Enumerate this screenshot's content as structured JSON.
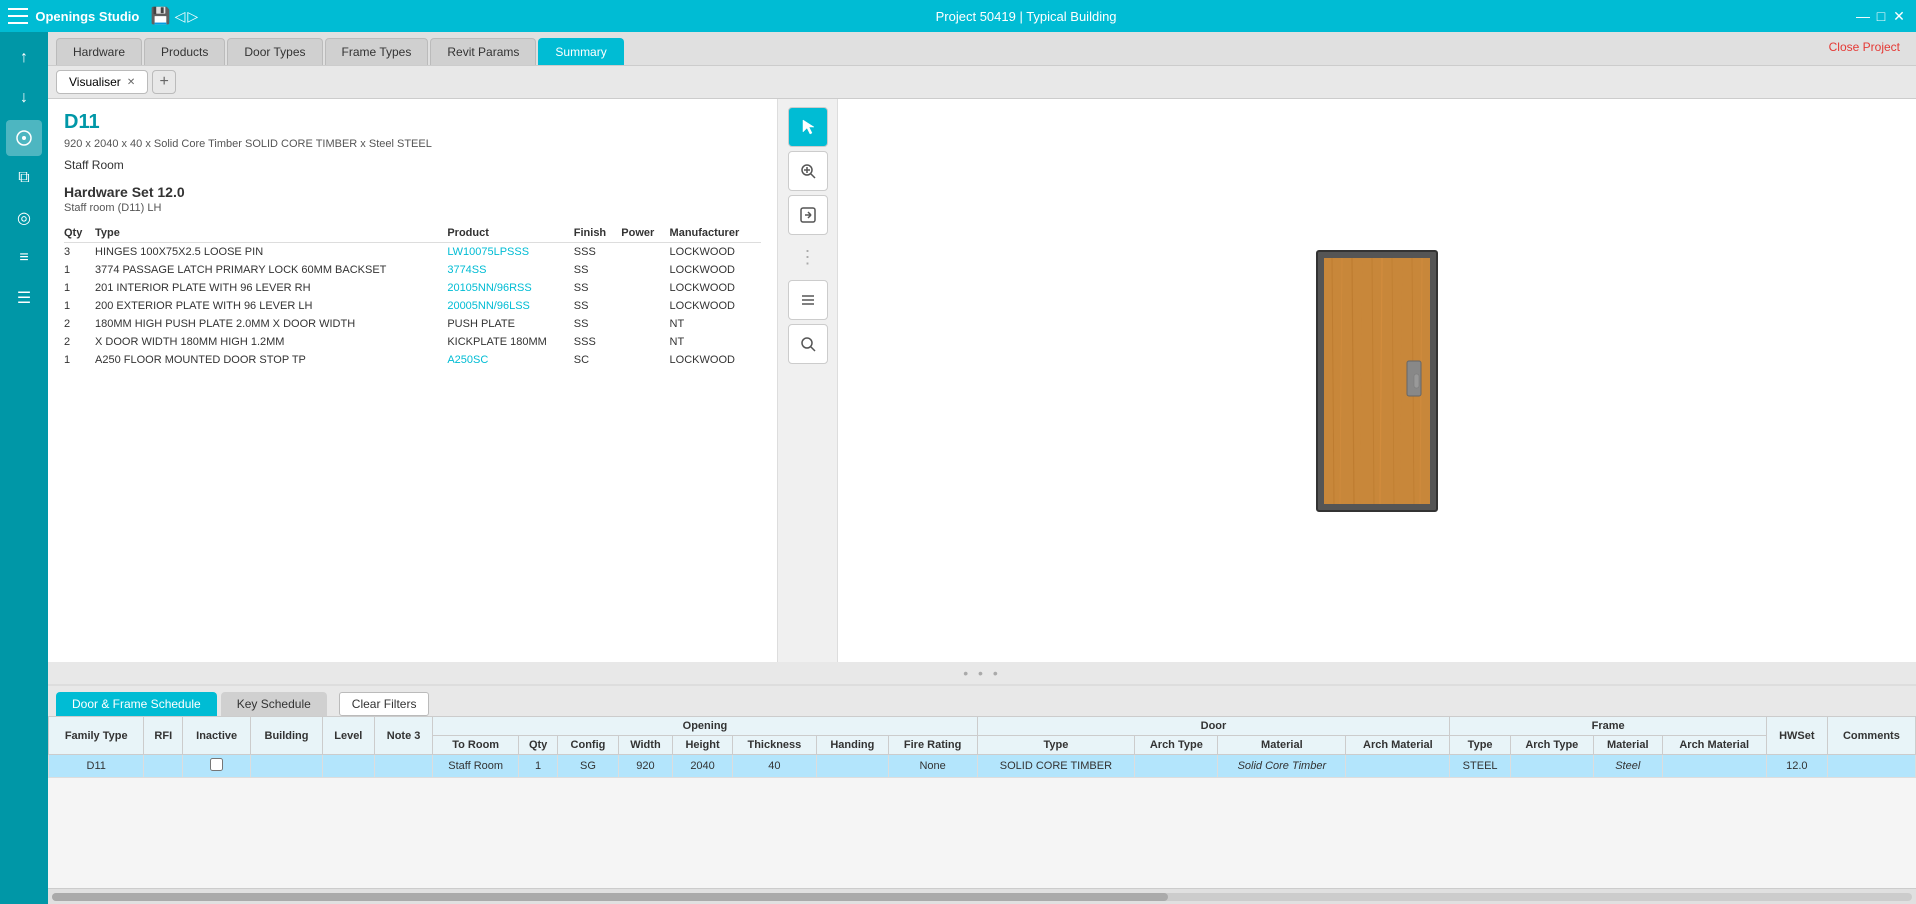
{
  "titleBar": {
    "appName": "Openings Studio",
    "projectTitle": "Project 50419 | Typical Building",
    "closeProject": "Close Project"
  },
  "tabs": [
    {
      "label": "Hardware",
      "active": false
    },
    {
      "label": "Products",
      "active": false
    },
    {
      "label": "Door Types",
      "active": false
    },
    {
      "label": "Frame Types",
      "active": false
    },
    {
      "label": "Revit Params",
      "active": false
    },
    {
      "label": "Summary",
      "active": true
    }
  ],
  "visualiserTab": {
    "label": "Visualiser",
    "addLabel": "+"
  },
  "detail": {
    "doorId": "D11",
    "doorSpec": "920 x 2040 x 40 x Solid Core Timber SOLID CORE TIMBER x Steel STEEL",
    "roomName": "Staff Room",
    "hardwareSetTitle": "Hardware Set 12.0",
    "hardwareSetSub": "Staff room (D11) LH"
  },
  "hardwareTable": {
    "headers": [
      "Qty",
      "Type",
      "Product",
      "Finish",
      "Power",
      "Manufacturer"
    ],
    "rows": [
      {
        "qty": "3",
        "type": "HINGES 100X75X2.5 LOOSE PIN",
        "product": "LW10075LPSSS",
        "finish": "SSS",
        "power": "",
        "manufacturer": "LOCKWOOD",
        "productIsLink": true
      },
      {
        "qty": "1",
        "type": "3774 PASSAGE LATCH PRIMARY LOCK 60MM BACKSET",
        "product": "3774SS",
        "finish": "SS",
        "power": "",
        "manufacturer": "LOCKWOOD",
        "productIsLink": true
      },
      {
        "qty": "1",
        "type": "201 INTERIOR PLATE WITH 96 LEVER RH",
        "product": "20105NN/96RSS",
        "finish": "SS",
        "power": "",
        "manufacturer": "LOCKWOOD",
        "productIsLink": true
      },
      {
        "qty": "1",
        "type": "200 EXTERIOR PLATE WITH 96 LEVER LH",
        "product": "20005NN/96LSS",
        "finish": "SS",
        "power": "",
        "manufacturer": "LOCKWOOD",
        "productIsLink": true
      },
      {
        "qty": "2",
        "type": "180MM HIGH PUSH PLATE 2.0MM X DOOR WIDTH",
        "product": "PUSH PLATE",
        "finish": "SS",
        "power": "",
        "manufacturer": "NT",
        "productIsLink": false
      },
      {
        "qty": "2",
        "type": "X DOOR WIDTH 180MM HIGH 1.2MM",
        "product": "KICKPLATE 180MM",
        "finish": "SSS",
        "power": "",
        "manufacturer": "NT",
        "productIsLink": false
      },
      {
        "qty": "1",
        "type": "A250 FLOOR MOUNTED DOOR STOP TP",
        "product": "A250SC",
        "finish": "SC",
        "power": "",
        "manufacturer": "LOCKWOOD",
        "productIsLink": true
      }
    ]
  },
  "visualiser": {
    "label": "Visualiser"
  },
  "schedule": {
    "doorFrameTab": "Door & Frame Schedule",
    "keyScheduleTab": "Key Schedule",
    "clearFilters": "Clear Filters",
    "columnGroups": {
      "opening": "Opening",
      "door": "Door",
      "frame": "Frame"
    },
    "headers": {
      "familyType": "Family Type",
      "rfi": "RFI",
      "inactive": "Inactive",
      "building": "Building",
      "level": "Level",
      "note3": "Note 3",
      "toRoom": "To Room",
      "qty": "Qty",
      "config": "Config",
      "width": "Width",
      "height": "Height",
      "thickness": "Thickness",
      "handing": "Handing",
      "fireRating": "Fire Rating",
      "doorType": "Type",
      "doorArchType": "Arch Type",
      "doorMaterial": "Material",
      "doorArchMaterial": "Arch Material",
      "frameType": "Type",
      "frameArchType": "Arch Type",
      "frameMaterial": "Material",
      "frameArchMaterial": "Arch Material",
      "hwSet": "HWSet",
      "comments": "Comments"
    },
    "rows": [
      {
        "familyType": "D11",
        "rfi": "",
        "inactive": "",
        "building": "",
        "level": "",
        "note3": "",
        "toRoom": "Staff Room",
        "qty": "1",
        "config": "SG",
        "width": "920",
        "height": "2040",
        "thickness": "40",
        "handing": "",
        "fireRating": "None",
        "doorType": "SOLID CORE TIMBER",
        "doorArchType": "",
        "doorMaterial": "Solid Core Timber",
        "doorArchMaterial": "",
        "frameType": "STEEL",
        "frameArchType": "",
        "frameMaterial": "Steel",
        "frameArchMaterial": "",
        "hwSet": "12.0",
        "comments": "",
        "selected": true
      }
    ]
  },
  "sidebarIcons": [
    {
      "name": "arrow-up-icon",
      "symbol": "↑",
      "interactable": true
    },
    {
      "name": "arrow-down-icon",
      "symbol": "↓",
      "interactable": true
    },
    {
      "name": "cursor-icon",
      "symbol": "⊕",
      "interactable": true,
      "active": true
    },
    {
      "name": "copy-icon",
      "symbol": "⧉",
      "interactable": true
    },
    {
      "name": "globe-icon",
      "symbol": "◎",
      "interactable": true
    },
    {
      "name": "list-icon",
      "symbol": "≡",
      "interactable": true
    },
    {
      "name": "lines-icon",
      "symbol": "☰",
      "interactable": true
    }
  ],
  "rightControls": [
    {
      "name": "select-icon",
      "symbol": "⬆",
      "active": true
    },
    {
      "name": "zoom-icon",
      "symbol": "⤢"
    },
    {
      "name": "enter-icon",
      "symbol": "⬆"
    },
    {
      "name": "list-view-icon",
      "symbol": "☰"
    },
    {
      "name": "search-icon",
      "symbol": "🔍"
    }
  ]
}
